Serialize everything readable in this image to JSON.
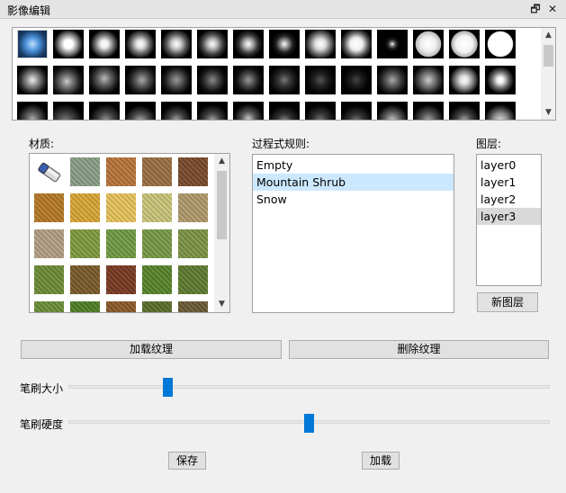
{
  "window": {
    "title": "影像编辑",
    "restore_glyph": "🗗",
    "close_glyph": "✕"
  },
  "brushes": {
    "scroll_up": "▲",
    "scroll_down": "▼",
    "icons": [
      "brush-stamp-icon"
    ]
  },
  "materials": {
    "label": "材质:",
    "eraser_icon": "eraser-icon",
    "scroll_up": "▲",
    "scroll_down": "▼"
  },
  "rules": {
    "label": "过程式规则:",
    "items": [
      "Empty",
      "Mountain Shrub",
      "Snow"
    ],
    "selected_index": 1
  },
  "layers": {
    "label": "图层:",
    "items": [
      "layer0",
      "layer1",
      "layer2",
      "layer3"
    ],
    "selected_index": 3,
    "new_layer_button": "新图层"
  },
  "actions": {
    "load_texture": "加载纹理",
    "delete_texture": "删除纹理",
    "save": "保存",
    "load": "加载"
  },
  "sliders": {
    "brush_size_label": "笔刷大小",
    "brush_size_value": 0.2,
    "brush_hardness_label": "笔刷硬度",
    "brush_hardness_value": 0.5
  },
  "colors": {
    "accent": "#0078d7",
    "selection_blue": "#cce8ff",
    "selection_gray": "#d9d9d9"
  }
}
